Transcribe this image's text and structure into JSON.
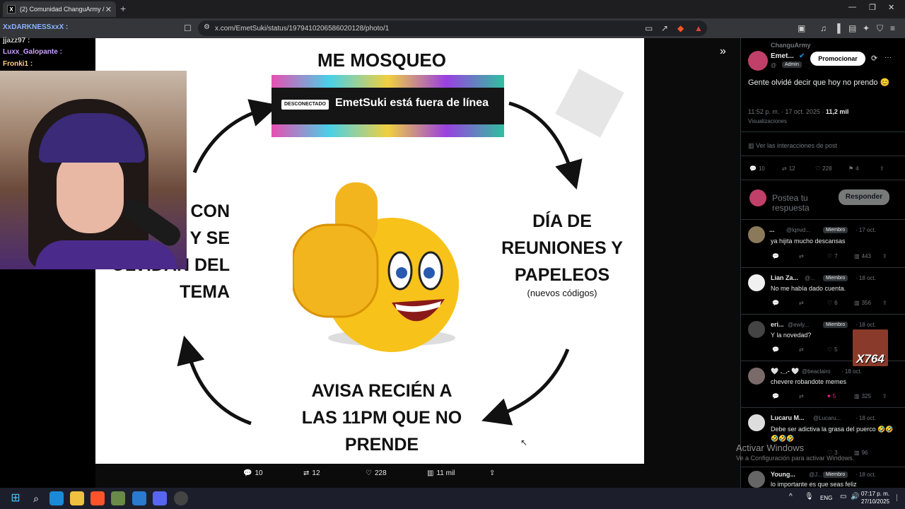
{
  "browser": {
    "tab_title": "(2) Comunidad ChanguArmy / X",
    "url": "x.com/EmetSuki/status/1979410206586020128/photo/1",
    "new_tab": "+",
    "tab_close": "✕"
  },
  "chat": [
    {
      "user": "XxDARKNESSxxX :",
      "color": "#8ab4ff"
    },
    {
      "user": "jjazz97 :",
      "color": "#d0d0d0"
    },
    {
      "user": "Luxx_Galopante :",
      "color": "#c9a0ff"
    },
    {
      "user": "Fronki1 :",
      "color": "#ffd080"
    }
  ],
  "slide": {
    "top": "ME MOSQUEO",
    "right_line1": "DÍA DE",
    "right_line2": "REUNIONES Y",
    "right_line3": "PAPELEOS",
    "right_sub": "(nuevos códigos)",
    "bottom_line1": "AVISA RECIÉN A",
    "bottom_line2": "LAS 11PM QUE NO",
    "bottom_line3": "PRENDE",
    "left_line1": "CON",
    "left_line2": "Y SE",
    "left_line3": "OLVIDAN DEL",
    "left_line4": "TEMA",
    "offline_tag": "DESCONECTADO",
    "offline_msg": "EmetSuki está fuera de línea"
  },
  "action_bar": {
    "replies": "10",
    "reposts": "12",
    "likes": "228",
    "views": "11 mil"
  },
  "panel": {
    "community": "ChanguArmy",
    "author": "Emet...",
    "author_handle": "@",
    "author_badge": "Admin",
    "promote_label": "Promocionar",
    "post_text": "Gente olvidé decir que hoy no prendo 😊",
    "timestamp": "11:52 p. m. · 17 oct. 2025 · ",
    "views_count": "11,2 mil",
    "views_label": "Visualizaciones",
    "interactions_link": "Ver las interacciones de post",
    "stats": {
      "replies": "10",
      "reposts": "12",
      "likes": "228",
      "bookmarks": "4"
    },
    "reply_placeholder": "Postea tu respuesta",
    "reply_button": "Responder",
    "replies": [
      {
        "name": "...",
        "handle": "@lqnvd...",
        "badge": "Miembro",
        "date": "· 17 oct.",
        "text": "ya hijita mucho descansas",
        "likes": "7",
        "views": "443",
        "avatar": "#8a7a5a"
      },
      {
        "name": "Lian Za...",
        "handle": "@...",
        "badge": "Miembro",
        "date": "· 18 oct.",
        "text": "No me había dado cuenta.",
        "likes": "6",
        "views": "356",
        "avatar": "#f0f0f0"
      },
      {
        "name": "eri...",
        "handle": "@ewly...",
        "badge": "Miembro",
        "date": "· 18 oct.",
        "text": "Y la novedad?",
        "likes": "5",
        "views": "",
        "avatar": "#444"
      },
      {
        "name": "🤍 ._.- 🤍",
        "handle": "@beaclairo",
        "badge": "",
        "date": "· 18 oct.",
        "text": "chevere robandote memes",
        "likes": "5",
        "views": "325",
        "avatar": "#7a6a6a"
      },
      {
        "name": "Lucaru M...",
        "handle": "@Lucaru...",
        "badge": "",
        "date": "· 18 oct.",
        "text": "Debe ser adictiva la grasa del puerco 🤣🤣🤣🤣🤣",
        "likes": "3",
        "views": "96",
        "avatar": "#ddd"
      },
      {
        "name": "Young...",
        "handle": "@J...",
        "badge": "Miembro",
        "date": "· 18 oct.",
        "text": "lo importante es que seas feliz",
        "likes": "",
        "views": "",
        "avatar": "#666"
      }
    ]
  },
  "overlay": {
    "activate_title": "Activar Windows",
    "activate_sub": "Ve a Configuración para activar Windows.",
    "x764": "X764"
  },
  "taskbar": {
    "lang": "ENG",
    "time": "07:17 p. m.",
    "date": "27/10/2025"
  }
}
